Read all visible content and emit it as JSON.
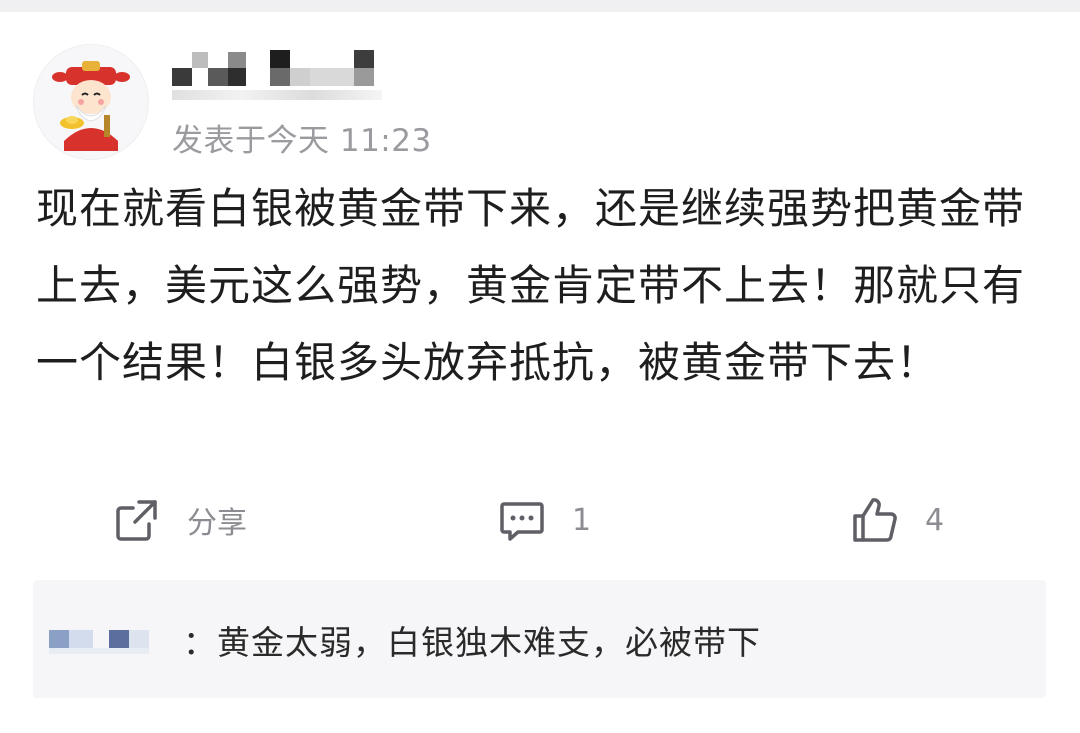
{
  "post": {
    "timestamp": "发表于今天 11:23",
    "content": "现在就看白银被黄金带下来，还是继续强势把黄金带上去，美元这么强势，黄金肯定带不上去！那就只有一个结果！白银多头放弃抵抗，被黄金带下去！",
    "avatar_icon": "god-of-wealth-avatar-icon"
  },
  "actions": {
    "share_label": "分享",
    "comment_count": "1",
    "like_count": "4"
  },
  "reply": {
    "text": "：黄金太弱，白银独木难支，必被带下"
  },
  "colors": {
    "text": "#1e1e1e",
    "muted": "#9a9a9f",
    "reply_bg": "#f6f6f8",
    "icon": "#5f5f66"
  }
}
